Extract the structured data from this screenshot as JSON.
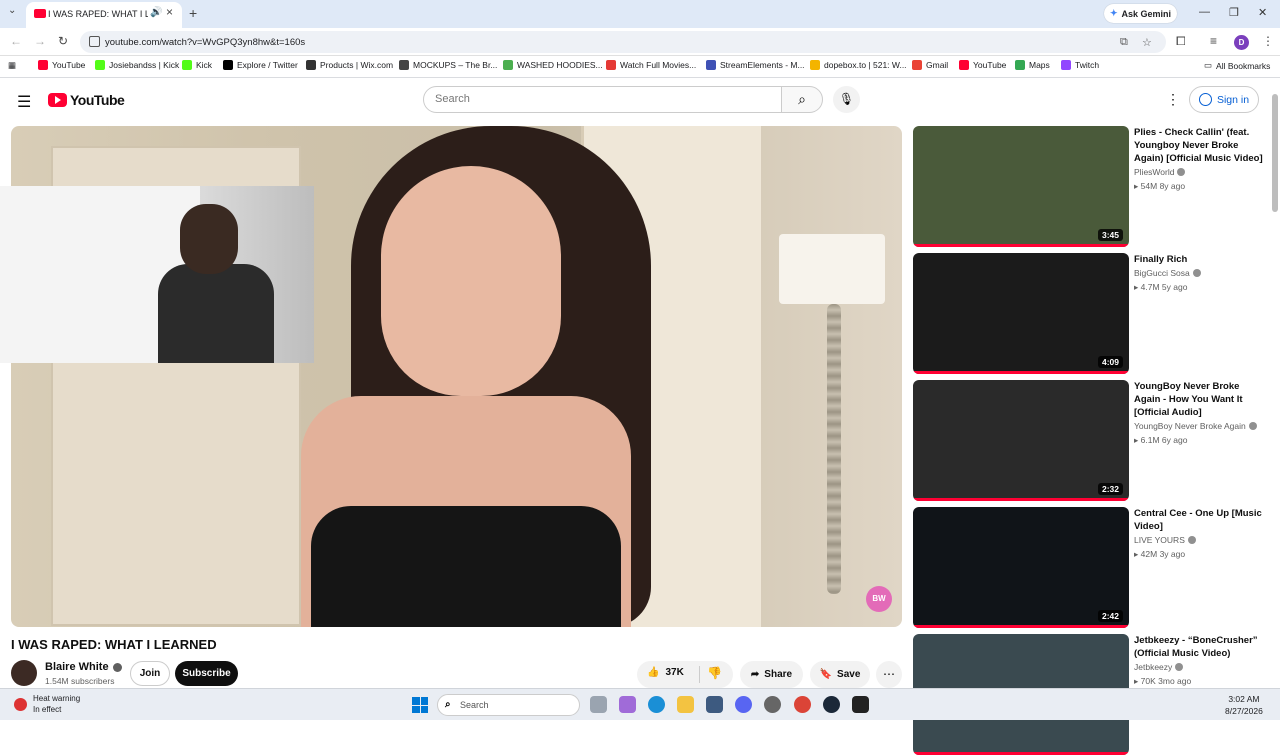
{
  "browser": {
    "tab_title": "I WAS RAPED: WHAT I LEARNED",
    "url": "youtube.com/watch?v=WvGPQ3yn8hw&t=160s",
    "ask_gemini": "Ask Gemini",
    "profile_initial": "D",
    "bookmarks": [
      {
        "label": "YouTube",
        "color": "#ff0033"
      },
      {
        "label": "Josiebandss | Kick",
        "color": "#53fc18"
      },
      {
        "label": "Kick",
        "color": "#53fc18"
      },
      {
        "label": "Explore / Twitter",
        "color": "#000000"
      },
      {
        "label": "Products | Wix.com",
        "color": "#333333"
      },
      {
        "label": "MOCKUPS – The Br...",
        "color": "#444444"
      },
      {
        "label": "WASHED HOODIES...",
        "color": "#4caf50"
      },
      {
        "label": "Watch Full Movies...",
        "color": "#e53935"
      },
      {
        "label": "StreamElements - M...",
        "color": "#3f51b5"
      },
      {
        "label": "dopebox.to | 521: W...",
        "color": "#f4b400"
      },
      {
        "label": "Gmail",
        "color": "#ea4335"
      },
      {
        "label": "YouTube",
        "color": "#ff0033"
      },
      {
        "label": "Maps",
        "color": "#34a853"
      },
      {
        "label": "Twitch",
        "color": "#9146ff"
      }
    ],
    "all_bookmarks": "All Bookmarks"
  },
  "youtube": {
    "logo_text": "YouTube",
    "search_placeholder": "Search",
    "sign_in": "Sign in"
  },
  "video": {
    "title": "I WAS RAPED: WHAT I LEARNED",
    "channel": "Blaire White",
    "subscribers": "1.54M subscribers",
    "join": "Join",
    "subscribe": "Subscribe",
    "likes": "37K",
    "share": "Share",
    "save": "Save",
    "watermark": "BW"
  },
  "recommendations": [
    {
      "title": "Plies - Check Callin' (feat. Youngboy Never Broke Again) [Official Music Video]",
      "channel": "PliesWorld",
      "views": "54M",
      "age": "8y ago",
      "duration": "3:45",
      "thumb_color": "#4a5a3a"
    },
    {
      "title": "Finally Rich",
      "channel": "BigGucci Sosa",
      "views": "4.7M",
      "age": "5y ago",
      "duration": "4:09",
      "thumb_color": "#1b1b1b"
    },
    {
      "title": "YoungBoy Never Broke Again - How You Want It [Official Audio]",
      "channel": "YoungBoy Never Broke Again",
      "views": "6.1M",
      "age": "6y ago",
      "duration": "2:32",
      "thumb_color": "#2a2a2a"
    },
    {
      "title": "Central Cee - One Up [Music Video]",
      "channel": "LIVE YOURS",
      "views": "42M",
      "age": "3y ago",
      "duration": "2:42",
      "thumb_color": "#101418"
    },
    {
      "title": "Jetbkeezy - “BoneCrusher” (Official Music Video)",
      "channel": "Jetbkeezy",
      "views": "70K",
      "age": "3mo ago",
      "duration": "",
      "thumb_color": "#3a4a50"
    }
  ],
  "taskbar": {
    "heat_title": "Heat warning",
    "heat_sub": "In effect",
    "search": "Search",
    "time": "3:02 AM",
    "date": "8/27/2026"
  }
}
